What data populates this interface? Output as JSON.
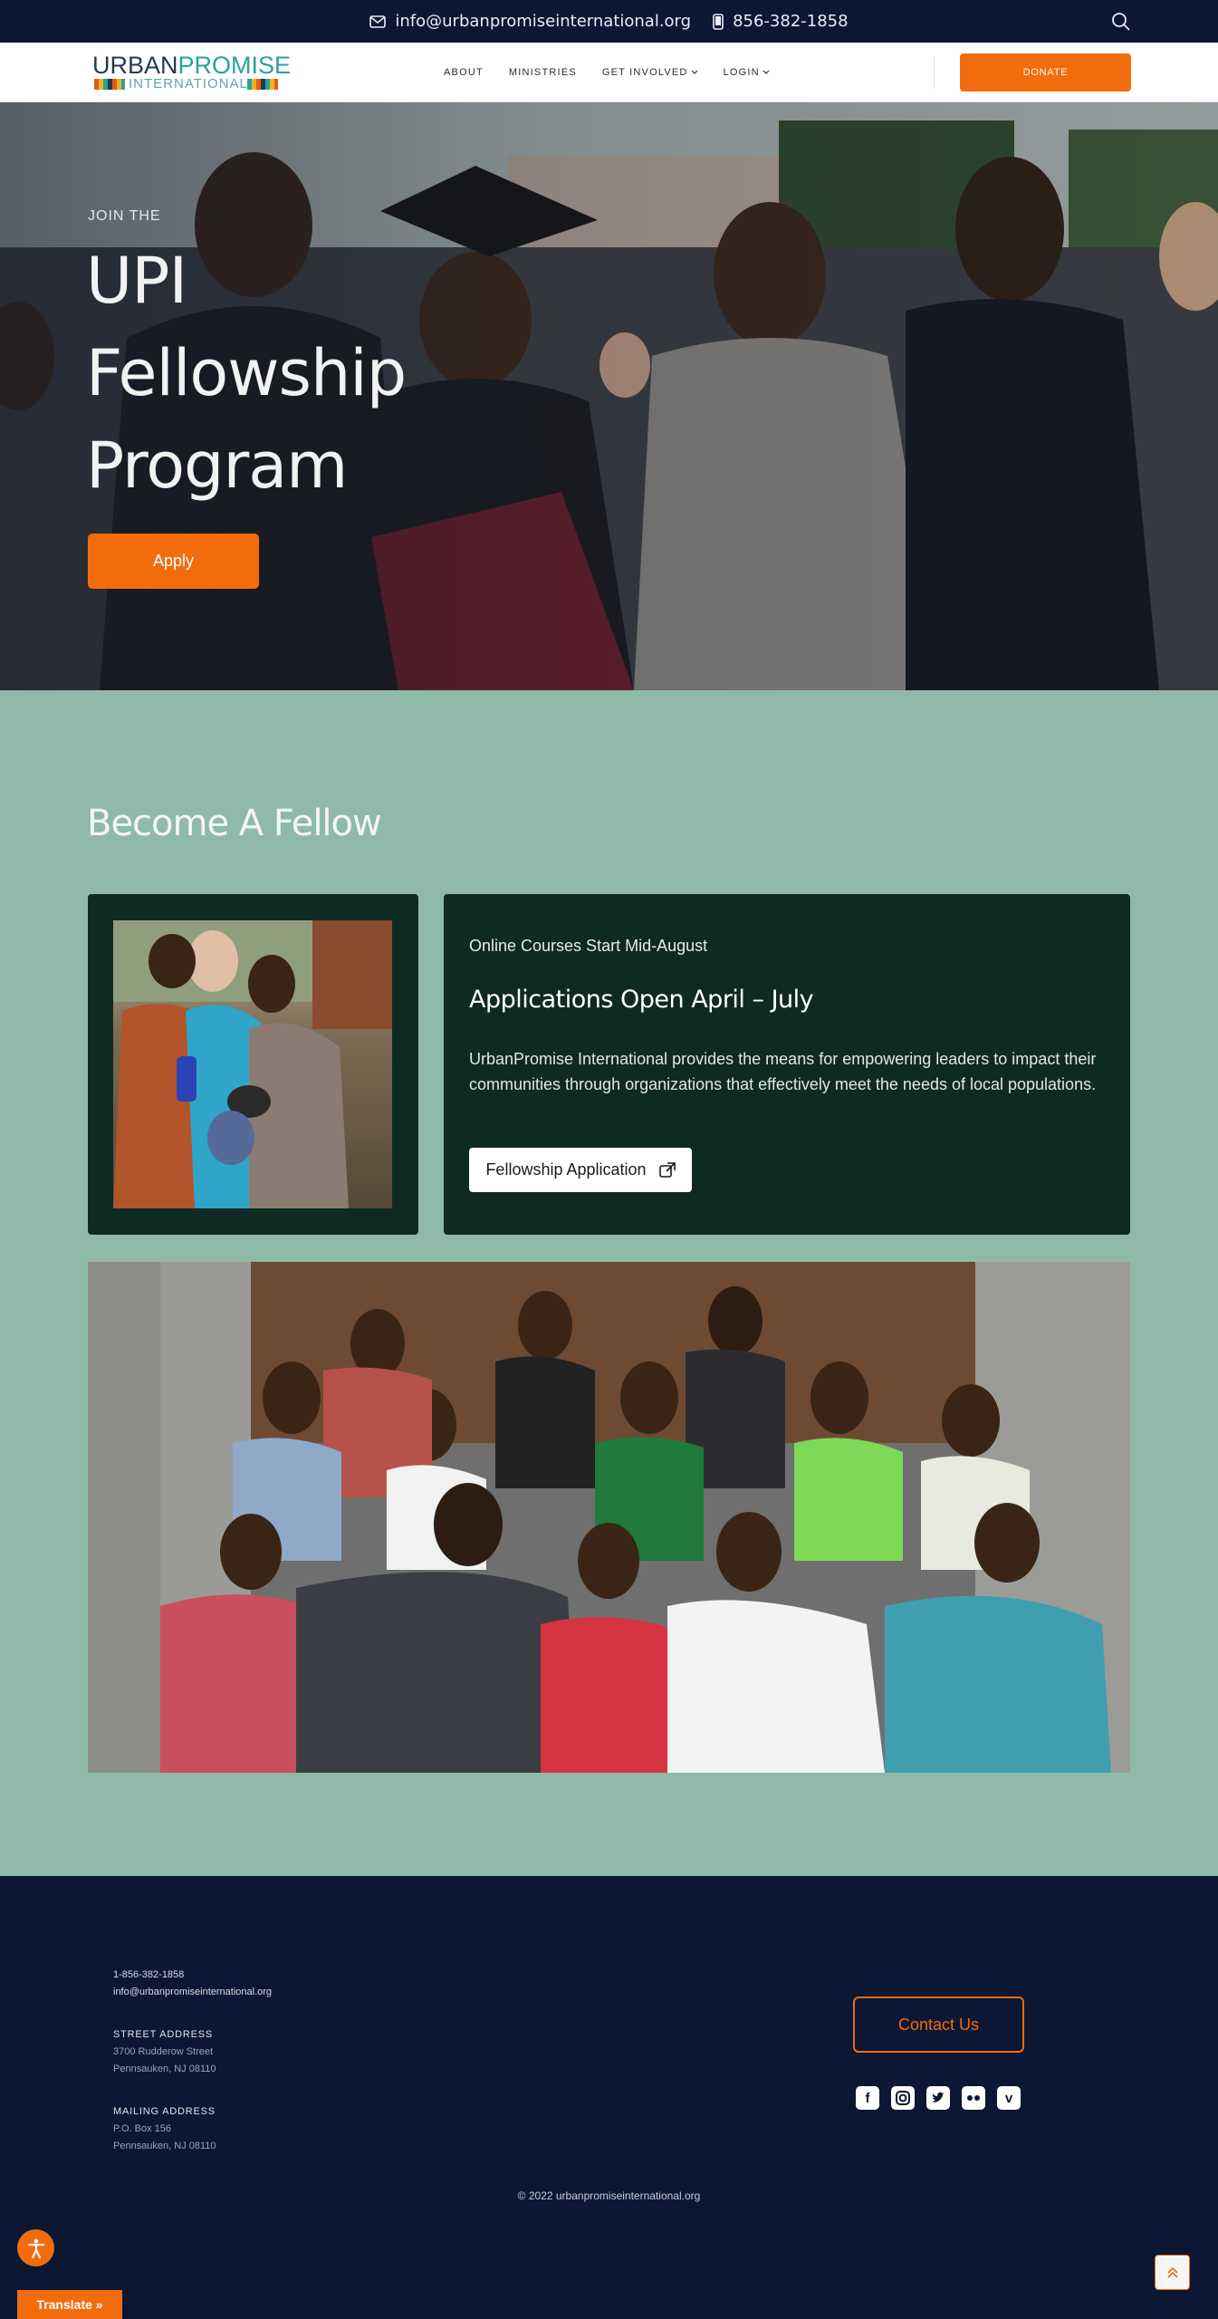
{
  "topbar": {
    "email": "info@urbanpromiseinternational.org",
    "phone": "856-382-1858"
  },
  "nav": {
    "logo_word_a": "URBAN",
    "logo_word_b": "PROMISE",
    "logo_sub": "INTERNATIONAL",
    "items": [
      {
        "label": "ABOUT",
        "dropdown": false
      },
      {
        "label": "MINISTRIES",
        "dropdown": false
      },
      {
        "label": "GET INVOLVED",
        "dropdown": true
      },
      {
        "label": "LOGIN",
        "dropdown": true
      }
    ],
    "donate_label": "DONATE"
  },
  "hero": {
    "kicker": "JOIN THE",
    "title_lines": [
      "UPI",
      "Fellowship",
      "Program"
    ],
    "apply_label": "Apply"
  },
  "fellow": {
    "title": "Become A Fellow",
    "subtitle": "Online Courses Start Mid-August",
    "heading": "Applications Open April – July",
    "body": "UrbanPromise International provides the means for empowering leaders to impact their communities through organizations that effectively meet the needs of local populations.",
    "button_label": "Fellowship Application"
  },
  "footer": {
    "phone": "1-856-382-1858",
    "email": "info@urbanpromiseinternational.org",
    "street_label": "STREET ADDRESS",
    "street_line1": "3700 Rudderow Street",
    "street_line2": "Pennsauken, NJ 08110",
    "mailing_label": "MAILING ADDRESS",
    "mailing_line1": "P.O. Box 156",
    "mailing_line2": "Pennsauken, NJ 08110",
    "contact_label": "Contact Us",
    "socials": [
      "facebook-icon",
      "instagram-icon",
      "twitter-icon",
      "flickr-icon",
      "vimeo-icon"
    ],
    "copyright": "© 2022 urbanpromiseinternational.org"
  },
  "widgets": {
    "translate_label": "Translate »"
  },
  "colors": {
    "navy": "#0b1733",
    "accent_orange": "#f26c0d",
    "sage": "#8fbaa9",
    "dark_green": "#0f2a23"
  }
}
